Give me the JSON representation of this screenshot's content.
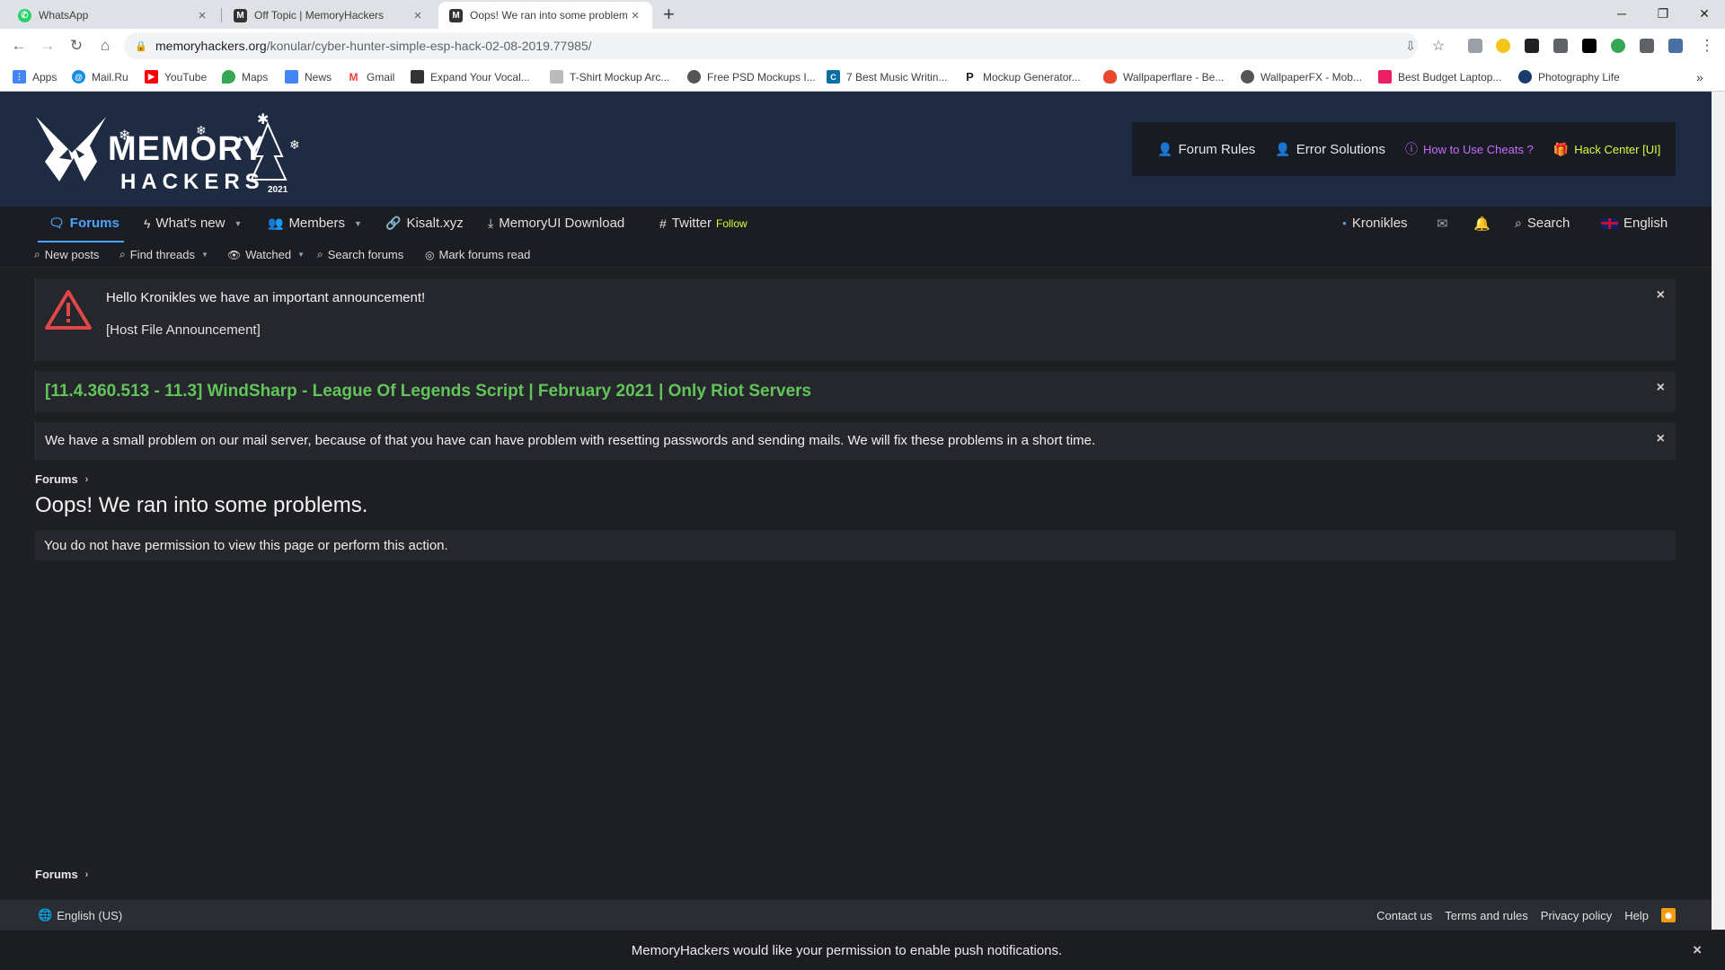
{
  "browser": {
    "tabs": [
      {
        "title": "WhatsApp",
        "icon": "whatsapp-icon"
      },
      {
        "title": "Off Topic | MemoryHackers",
        "icon": "memoryhackers-icon"
      },
      {
        "title": "Oops! We ran into some problem",
        "icon": "memoryhackers-icon"
      }
    ],
    "url_host": "memoryhackers.org",
    "url_path": "/konular/cyber-hunter-simple-esp-hack-02-08-2019.77985/",
    "bookmarks": [
      "Apps",
      "Mail.Ru",
      "YouTube",
      "Maps",
      "News",
      "Gmail",
      "Expand Your Vocal...",
      "T-Shirt Mockup Arc...",
      "Free PSD Mockups I...",
      "7 Best Music Writin...",
      "Mockup Generator...",
      "Wallpaperflare - Be...",
      "WallpaperFX - Mob...",
      "Best Budget Laptop...",
      "Photography Life"
    ]
  },
  "header": {
    "logo_text_top": "MEMORY",
    "logo_text_bottom": "HACKERS",
    "logo_year": "2021",
    "links": {
      "forum_rules": "Forum Rules",
      "error_solutions": "Error Solutions",
      "how_to_use": "How to Use Cheats ?",
      "hack_center": "Hack Center [UI]"
    },
    "colors": {
      "how_to_use": "#c86bff",
      "hack_center": "#d8ff3a",
      "background": "#1f2b43"
    }
  },
  "nav": {
    "forums": "Forums",
    "whats_new": "What's new",
    "members": "Members",
    "kisalt": "Kisalt.xyz",
    "memoryui": "MemoryUI Download",
    "twitter": "Twitter",
    "twitter_follow": "Follow",
    "user": "Kronikles",
    "search": "Search",
    "language": "English"
  },
  "subnav": {
    "new_posts": "New posts",
    "find_threads": "Find threads",
    "watched": "Watched",
    "search_forums": "Search forums",
    "mark_read": "Mark forums read"
  },
  "notices": {
    "announcement_line1": "Hello Kronikles we have an important announcement!",
    "announcement_line2": "[Host File Announcement]",
    "promo": "[11.4.360.513 - 11.3] WindSharp - League Of Legends Script | February 2021 | Only Riot Servers",
    "mail_problem": "We have a small problem on our mail server, because of that you have can have problem with resetting passwords and sending mails. We will fix these problems in a short time.",
    "close_glyph": "×"
  },
  "breadcrumb": {
    "label": "Forums",
    "chevron": "›"
  },
  "page": {
    "title": "Oops! We ran into some problems.",
    "error_message": "You do not have permission to view this page or perform this action."
  },
  "footer": {
    "language": "English (US)",
    "links": [
      "Contact us",
      "Terms and rules",
      "Privacy policy",
      "Help"
    ]
  },
  "push": {
    "message": "MemoryHackers would like your permission to enable push notifications.",
    "close_glyph": "×"
  }
}
